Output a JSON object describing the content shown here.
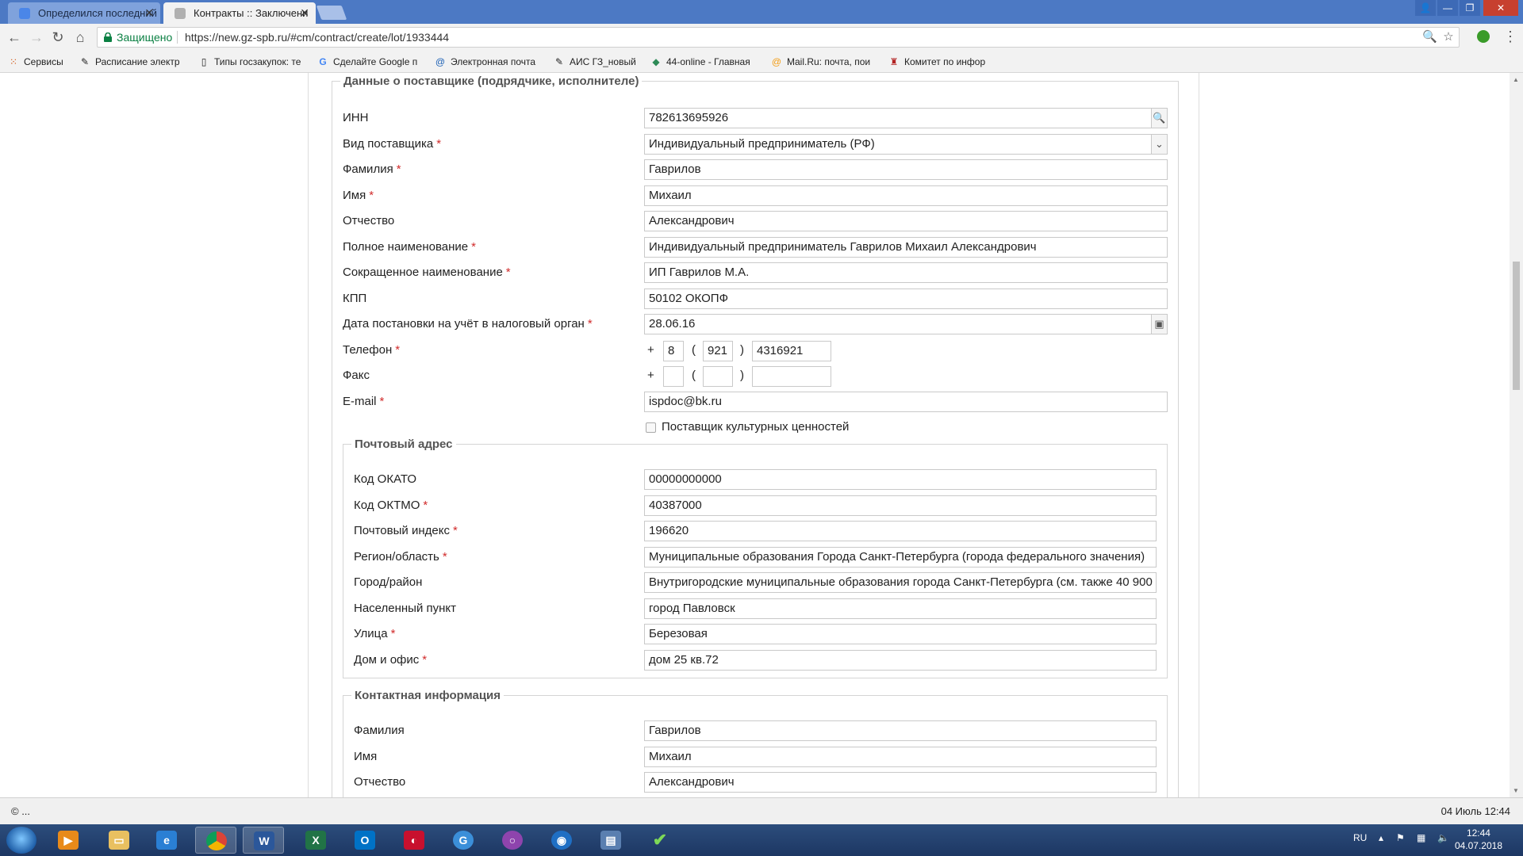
{
  "tabs": [
    {
      "title": "Определился последний",
      "active": false
    },
    {
      "title": "Контракты :: Заключени",
      "active": true
    }
  ],
  "toolbar": {
    "security_label": "Защищено",
    "url": "https://new.gz-spb.ru/#cm/contract/create/lot/1933444"
  },
  "bookmarks": [
    {
      "label": "Сервисы",
      "icon": "apps-icon"
    },
    {
      "label": "Расписание электр",
      "icon": "tool-icon"
    },
    {
      "label": "Типы госзакупок: те",
      "icon": "page-icon"
    },
    {
      "label": "Сделайте Google п",
      "icon": "google-icon"
    },
    {
      "label": "Электронная почта",
      "icon": "at-icon"
    },
    {
      "label": "АИС ГЗ_новый",
      "icon": "tool-icon"
    },
    {
      "label": "44-online - Главная",
      "icon": "diamond-icon"
    },
    {
      "label": "Mail.Ru: почта, пои",
      "icon": "at-icon"
    },
    {
      "label": "Комитет по инфор",
      "icon": "emblem-icon"
    }
  ],
  "supplier": {
    "legend": "Данные о поставщике (подрядчике, исполнителе)",
    "inn": {
      "label": "ИНН",
      "value": "782613695926"
    },
    "type": {
      "label": "Вид поставщика",
      "value": "Индивидуальный предприниматель (РФ)"
    },
    "last_name": {
      "label": "Фамилия",
      "value": "Гаврилов"
    },
    "first_name": {
      "label": "Имя",
      "value": "Михаил"
    },
    "middle_name": {
      "label": "Отчество",
      "value": "Александрович"
    },
    "full_name": {
      "label": "Полное наименование",
      "value": "Индивидуальный предприниматель Гаврилов Михаил Александрович"
    },
    "short_name": {
      "label": "Сокращенное наименование",
      "value": "ИП Гаврилов М.А."
    },
    "kpp": {
      "label": "КПП",
      "value": "50102 ОКОПФ"
    },
    "tax_date": {
      "label": "Дата постановки на учёт в налоговый орган",
      "value": "28.06.16"
    },
    "phone": {
      "label": "Телефон",
      "country": "8",
      "area": "921",
      "number": "4316921"
    },
    "fax": {
      "label": "Факс",
      "country": "",
      "area": "",
      "number": ""
    },
    "email": {
      "label": "E-mail",
      "value": "ispdoc@bk.ru"
    },
    "culture_checkbox": {
      "label": "Поставщик культурных ценностей",
      "checked": false
    }
  },
  "phone_symbols": {
    "plus": "+",
    "open": "(",
    "close": ")"
  },
  "required_mark": "*",
  "postal": {
    "legend": "Почтовый адрес",
    "okato": {
      "label": "Код ОКАТО",
      "value": "00000000000"
    },
    "oktmo": {
      "label": "Код ОКТМО",
      "value": "40387000"
    },
    "index": {
      "label": "Почтовый индекс",
      "value": "196620"
    },
    "region": {
      "label": "Регион/область",
      "value": "Муниципальные образования Города Санкт-Петербурга (города федерального значения)"
    },
    "city": {
      "label": "Город/район",
      "value": "Внутригородские муниципальные образования города Санкт-Петербурга (см. также 40 900"
    },
    "settlement": {
      "label": "Населенный пункт",
      "value": "город Павловск"
    },
    "street": {
      "label": "Улица",
      "value": "Березовая"
    },
    "house": {
      "label": "Дом и офис",
      "value": "дом 25 кв.72"
    }
  },
  "contact": {
    "legend": "Контактная информация",
    "last_name": {
      "label": "Фамилия",
      "value": "Гаврилов"
    },
    "first_name": {
      "label": "Имя",
      "value": "Михаил"
    },
    "middle_name": {
      "label": "Отчество",
      "value": "Александрович"
    }
  },
  "statusbar": {
    "left": "© ...",
    "right": "04 Июль 12:44"
  },
  "taskbar": {
    "lang": "RU",
    "time": "12:44",
    "date": "04.07.2018"
  },
  "colors": {
    "required": "#d12b2b",
    "secure": "#0b8043",
    "tab_bar": "#4c79c4"
  }
}
